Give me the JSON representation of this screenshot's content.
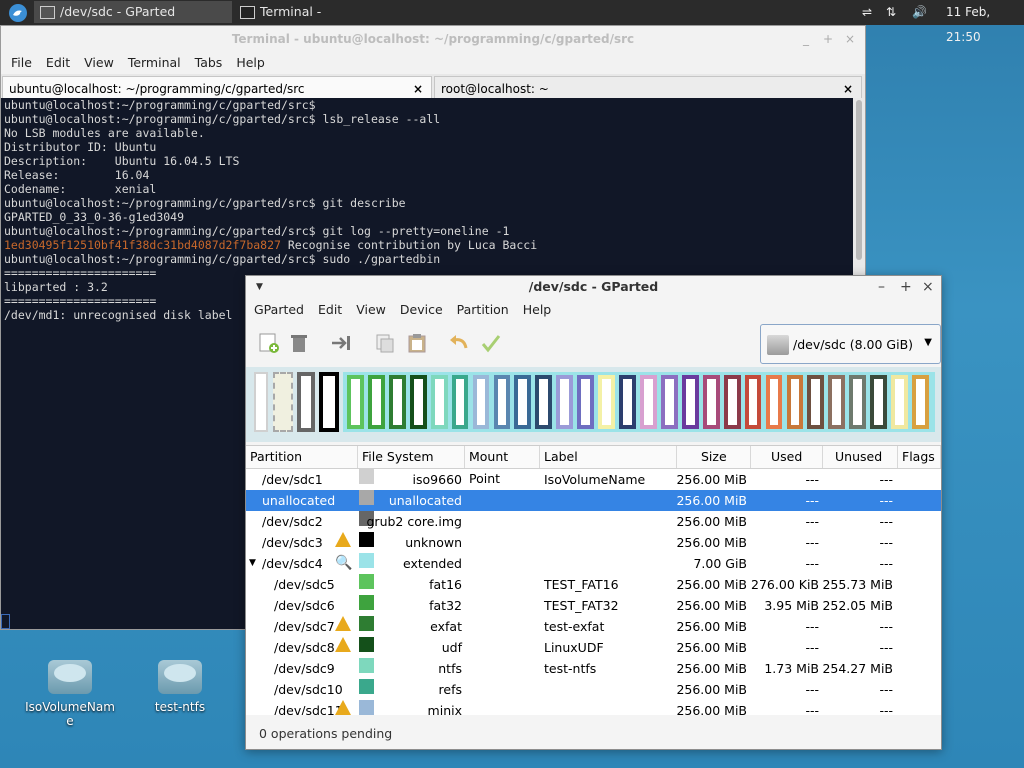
{
  "panel": {
    "tasks": [
      {
        "label": "/dev/sdc - GParted",
        "active": true
      },
      {
        "label": "Terminal - ubuntu@localhost...",
        "active": false
      }
    ],
    "clock": "11 Feb, 21:50"
  },
  "terminal": {
    "title": "Terminal - ubuntu@localhost: ~/programming/c/gparted/src",
    "menu": [
      "File",
      "Edit",
      "View",
      "Terminal",
      "Tabs",
      "Help"
    ],
    "tabs": [
      "ubuntu@localhost: ~/programming/c/gparted/src",
      "root@localhost: ~"
    ],
    "lines": [
      "ubuntu@localhost:~/programming/c/gparted/src$",
      "ubuntu@localhost:~/programming/c/gparted/src$ lsb_release --all",
      "No LSB modules are available.",
      "Distributor ID:\tUbuntu",
      "Description:\tUbuntu 16.04.5 LTS",
      "Release:\t16.04",
      "Codename:\txenial",
      "ubuntu@localhost:~/programming/c/gparted/src$ git describe",
      "GPARTED_0_33_0-36-g1ed3049",
      "ubuntu@localhost:~/programming/c/gparted/src$ git log --pretty=oneline -1",
      "",
      "ubuntu@localhost:~/programming/c/gparted/src$ sudo ./gpartedbin",
      "======================",
      "libparted : 3.2",
      "======================",
      "/dev/md1: unrecognised disk label"
    ],
    "commit_hash": "1ed30495f12510bf41f38dc31bd4087d2f7ba827",
    "commit_msg": " Recognise contribution by Luca Bacci"
  },
  "desktop_icons": [
    "IsoVolumeName",
    "test-ntfs"
  ],
  "gparted": {
    "title": "/dev/sdc - GParted",
    "menu": [
      "GParted",
      "Edit",
      "View",
      "Device",
      "Partition",
      "Help"
    ],
    "device": "/dev/sdc   (8.00 GiB)",
    "columns": [
      "Partition",
      "File System",
      "Mount Point",
      "Label",
      "Size",
      "Used",
      "Unused",
      "Flags"
    ],
    "rows": [
      {
        "partition": "/dev/sdc1",
        "fs": "iso9660",
        "color": "#d0d0d0",
        "label": "IsoVolumeName",
        "size": "256.00 MiB",
        "used": "---",
        "unused": "---",
        "indent": 0,
        "icon": ""
      },
      {
        "partition": "unallocated",
        "fs": "unallocated",
        "color": "#a8a8a8",
        "label": "",
        "size": "256.00 MiB",
        "used": "---",
        "unused": "---",
        "indent": 0,
        "icon": "",
        "selected": true
      },
      {
        "partition": "/dev/sdc2",
        "fs": "grub2 core.img",
        "color": "#666666",
        "label": "",
        "size": "256.00 MiB",
        "used": "---",
        "unused": "---",
        "indent": 0,
        "icon": ""
      },
      {
        "partition": "/dev/sdc3",
        "fs": "unknown",
        "color": "#000000",
        "label": "",
        "size": "256.00 MiB",
        "used": "---",
        "unused": "---",
        "indent": 0,
        "icon": "warn"
      },
      {
        "partition": "/dev/sdc4",
        "fs": "extended",
        "color": "#9be3e8",
        "label": "",
        "size": "7.00 GiB",
        "used": "---",
        "unused": "---",
        "indent": 0,
        "icon": "key",
        "expander": true
      },
      {
        "partition": "/dev/sdc5",
        "fs": "fat16",
        "color": "#5dc45d",
        "label": "TEST_FAT16",
        "size": "256.00 MiB",
        "used": "276.00 KiB",
        "unused": "255.73 MiB",
        "indent": 1,
        "icon": ""
      },
      {
        "partition": "/dev/sdc6",
        "fs": "fat32",
        "color": "#3ea33e",
        "label": "TEST_FAT32",
        "size": "256.00 MiB",
        "used": "3.95 MiB",
        "unused": "252.05 MiB",
        "indent": 1,
        "icon": ""
      },
      {
        "partition": "/dev/sdc7",
        "fs": "exfat",
        "color": "#2e7d32",
        "label": "test-exfat",
        "size": "256.00 MiB",
        "used": "---",
        "unused": "---",
        "indent": 1,
        "icon": "warn"
      },
      {
        "partition": "/dev/sdc8",
        "fs": "udf",
        "color": "#14501a",
        "label": "LinuxUDF",
        "size": "256.00 MiB",
        "used": "---",
        "unused": "---",
        "indent": 1,
        "icon": "warn"
      },
      {
        "partition": "/dev/sdc9",
        "fs": "ntfs",
        "color": "#7ed8bd",
        "label": "test-ntfs",
        "size": "256.00 MiB",
        "used": "1.73 MiB",
        "unused": "254.27 MiB",
        "indent": 1,
        "icon": ""
      },
      {
        "partition": "/dev/sdc10",
        "fs": "refs",
        "color": "#3aa88c",
        "label": "",
        "size": "256.00 MiB",
        "used": "---",
        "unused": "---",
        "indent": 1,
        "icon": ""
      },
      {
        "partition": "/dev/sdc11",
        "fs": "minix",
        "color": "#9ab8d8",
        "label": "",
        "size": "256.00 MiB",
        "used": "---",
        "unused": "---",
        "indent": 1,
        "icon": "warn"
      }
    ],
    "strip_colors": [
      "#5dc45d",
      "#3ea33e",
      "#2e7d32",
      "#14501a",
      "#7ed8bd",
      "#3aa88c",
      "#9ab8d8",
      "#5a86b0",
      "#3a6a96",
      "#2c4a6e",
      "#9b9bd8",
      "#6e6ec0",
      "#f4f1a6",
      "#2c3e6e",
      "#d8a0d0",
      "#8c6ec0",
      "#6a3a9e",
      "#a84a7a",
      "#8c3a4a",
      "#c44a3a",
      "#e87a4a",
      "#c8783a",
      "#6e5040",
      "#8c7060",
      "#6e7a6e",
      "#3a4a3a",
      "#f0e8a0",
      "#d8a040"
    ],
    "status": "0 operations pending"
  }
}
